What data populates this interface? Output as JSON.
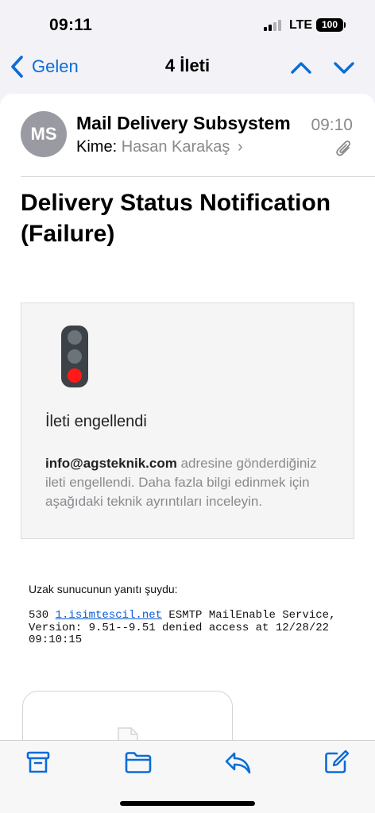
{
  "status": {
    "time": "09:11",
    "network": "LTE",
    "battery": "100"
  },
  "nav": {
    "back_label": "Gelen",
    "title": "4 İleti"
  },
  "email": {
    "avatar_initials": "MS",
    "sender": "Mail Delivery Subsystem",
    "time": "09:10",
    "to_label": "Kime:",
    "to_name": "Hasan Karakaş",
    "subject": "Delivery Status Notification (Failure)"
  },
  "notice": {
    "title": "İleti engellendi",
    "email": "info@agsteknik.com",
    "message": " adresine gönderdiğiniz ileti engellendi. Daha fazla bilgi edinmek için aşağıdaki teknik ayrıntıları inceleyin."
  },
  "technical": {
    "remote_label": "Uzak sunucunun yanıtı şuydu:",
    "code": "530 ",
    "link": "1.isimtescil.net",
    "response_line1": " ESMTP MailEnable Service,",
    "response_line2": "Version: 9.51--9.51 denied access at 12/28/22",
    "response_line3": "09:10:15"
  },
  "toolbar": {
    "icons": [
      "archive-icon",
      "folder-icon",
      "reply-icon",
      "compose-icon"
    ]
  },
  "colors": {
    "accent": "#0a6cd6",
    "secondary_text": "#8a8a8e",
    "stop_red": "#ff1a1a"
  }
}
